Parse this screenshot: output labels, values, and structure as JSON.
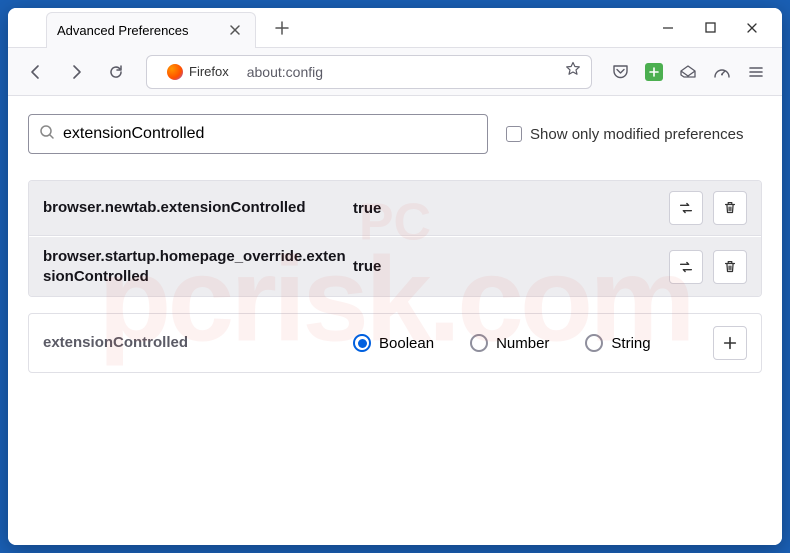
{
  "tab": {
    "title": "Advanced Preferences"
  },
  "urlbar": {
    "badge": "Firefox",
    "url": "about:config"
  },
  "search": {
    "value": "extensionControlled",
    "show_only_label": "Show only modified preferences"
  },
  "prefs": [
    {
      "name": "browser.newtab.extensionControlled",
      "value": "true"
    },
    {
      "name": "browser.startup.homepage_override.extensionControlled",
      "value": "true"
    }
  ],
  "new_pref": {
    "name": "extensionControlled",
    "types": [
      "Boolean",
      "Number",
      "String"
    ],
    "selected": 0
  },
  "watermark": {
    "big": "pcrisk.com",
    "small": "PC"
  }
}
